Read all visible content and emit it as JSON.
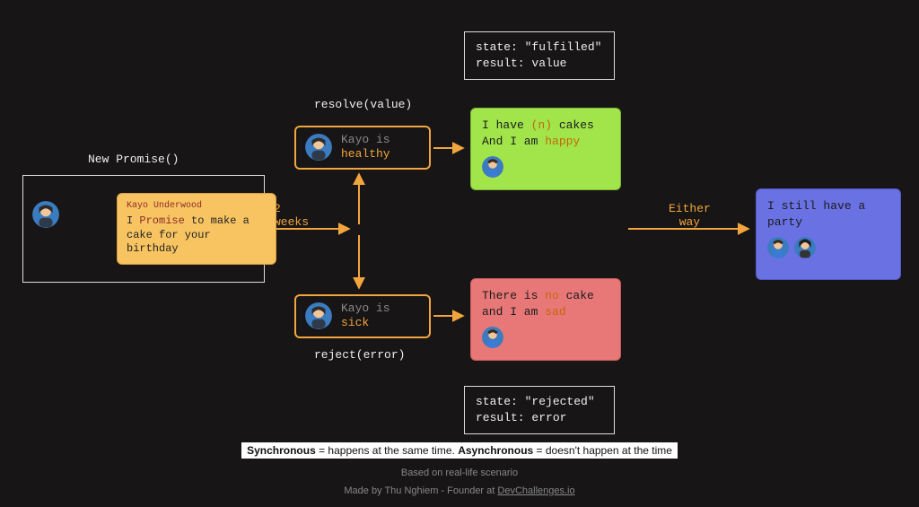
{
  "promise": {
    "title": "New Promise()",
    "speaker": "Kayo Underwood",
    "text_pre": "I ",
    "text_hl": "Promise",
    "text_post": " to make a cake for your birthday"
  },
  "arrows": {
    "two_weeks_1": "2",
    "two_weeks_2": "weeks",
    "either_1": "Either",
    "either_2": "way"
  },
  "resolve": {
    "label": "resolve(value)",
    "who_pre": "Kayo is",
    "who_state": "healthy",
    "state_line1": "state: \"fulfilled\"",
    "state_line2": "result: value"
  },
  "reject": {
    "label": "reject(error)",
    "who_pre": "Kayo is",
    "who_state": "sick",
    "state_line1": "state: \"rejected\"",
    "state_line2": "result: error"
  },
  "then_card": {
    "line1_pre": "I have ",
    "line1_hl": "(n)",
    "line1_post": " cakes",
    "line2_pre": "And I am ",
    "line2_hl": "happy"
  },
  "catch_card": {
    "line1_pre": "There is ",
    "line1_hl": "no",
    "line1_post": " cake",
    "line2_pre": "and I am ",
    "line2_hl": "sad"
  },
  "finally_card": {
    "line1": "I still have a",
    "line2": "party"
  },
  "footer": {
    "syn_b1": "Synchronous",
    "syn_t1": " = happens at the same time. ",
    "syn_b2": "Asynchronous",
    "syn_t2": " = doesn't happen at the time",
    "based": "Based on real-life scenario",
    "made_pre": "Made by Thu Nghiem - Founder at ",
    "made_link": "DevChallenges.io"
  }
}
